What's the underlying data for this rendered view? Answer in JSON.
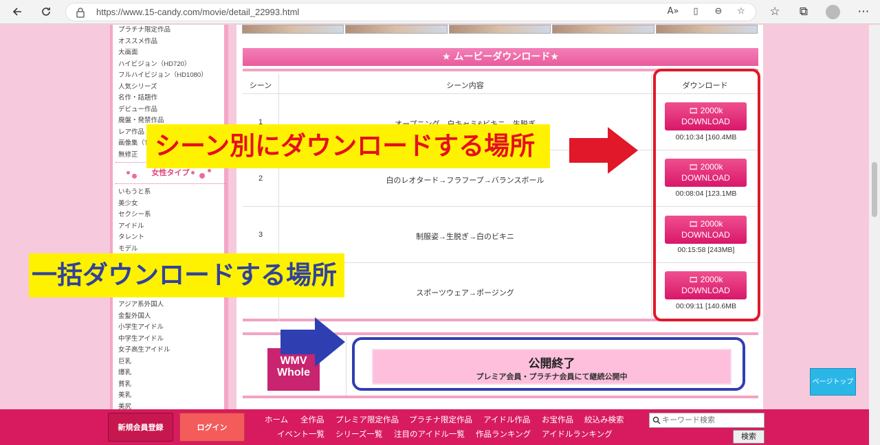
{
  "browser": {
    "url": "https://www.15-candy.com/movie/detail_22993.html",
    "nav_icons": [
      "back-arrow-icon",
      "refresh-icon"
    ],
    "url_icons": [
      "read-aloud-icon",
      "reader-view-icon",
      "zoom-icon",
      "add-favorite-icon"
    ],
    "toolbar_icons": [
      "favorites-icon",
      "collections-icon",
      "profile-icon",
      "more-icon"
    ]
  },
  "sidebar": {
    "items_top": [
      "プラチナ限定作品",
      "オススメ作品",
      "大画面",
      "ハイビジョン（HD720）",
      "フルハイビジョン（HD1080）",
      "人気シリーズ",
      "名作・話題作",
      "デビュー作品",
      "廃盤・発禁作品",
      "レア作品",
      "画像集（T",
      "無修正"
    ],
    "section_header": "女性タイプ",
    "items_mid": [
      "いもうと系",
      "美少女",
      "セクシー系",
      "アイドル",
      "タレント",
      "モデル"
    ],
    "items_bottom": [
      "アジア系外国人",
      "金髪外国人",
      "小学生アイドル",
      "中学生アイドル",
      "女子高生アイドル",
      "巨乳",
      "爆乳",
      "貧乳",
      "美乳",
      "美尻"
    ]
  },
  "main": {
    "movie_header": "★ ムービーダウンロード★",
    "table": {
      "headers": [
        "シーン",
        "シーン内容",
        "ダウンロード"
      ],
      "rows": [
        {
          "scene": "1",
          "content": "オープニング→白キャミ&ビキニ→生脱ぎ",
          "btn_top": "2000k",
          "btn_bottom": "DOWNLOAD",
          "duration": "00:10:34 [160.4MB"
        },
        {
          "scene": "2",
          "content": "白のレオタード→フラフープ→バランスボール",
          "btn_top": "2000k",
          "btn_bottom": "DOWNLOAD",
          "duration": "00:08:04 [123.1MB"
        },
        {
          "scene": "3",
          "content": "制服姿→生脱ぎ→白のビキニ",
          "btn_top": "2000k",
          "btn_bottom": "DOWNLOAD",
          "duration": "00:15:58 [243MB]"
        },
        {
          "scene": "",
          "content": "スポーツウェア→ポージング",
          "btn_top": "2000k",
          "btn_bottom": "DOWNLOAD",
          "duration": "00:09:11 [140.6MB"
        }
      ]
    },
    "whole": {
      "icon_line1": "WMV",
      "icon_line2": "Whole",
      "status_title": "公開終了",
      "status_sub": "プレミア会員・プラチナ会員にて継続公開中"
    }
  },
  "annotations": {
    "scene_label": "シーン別にダウンロードする場所",
    "bulk_label": "一括ダウンロードする場所",
    "red_color": "#e0182a",
    "blue_color": "#2f3fb2",
    "label_bg": "#fff200"
  },
  "page_top_button": "ページトップ",
  "footer": {
    "register": "新規会員登録",
    "login": "ログイン",
    "links_row1": [
      "ホーム",
      "全作品",
      "プレミア限定作品",
      "プラチナ限定作品",
      "アイドル作品",
      "お宝作品",
      "絞込み検索"
    ],
    "links_row2": [
      "イベント一覧",
      "シリーズ一覧",
      "注目のアイドル一覧",
      "作品ランキング",
      "アイドルランキング"
    ],
    "search_placeholder": "キーワード検索",
    "search_button": "検索"
  }
}
